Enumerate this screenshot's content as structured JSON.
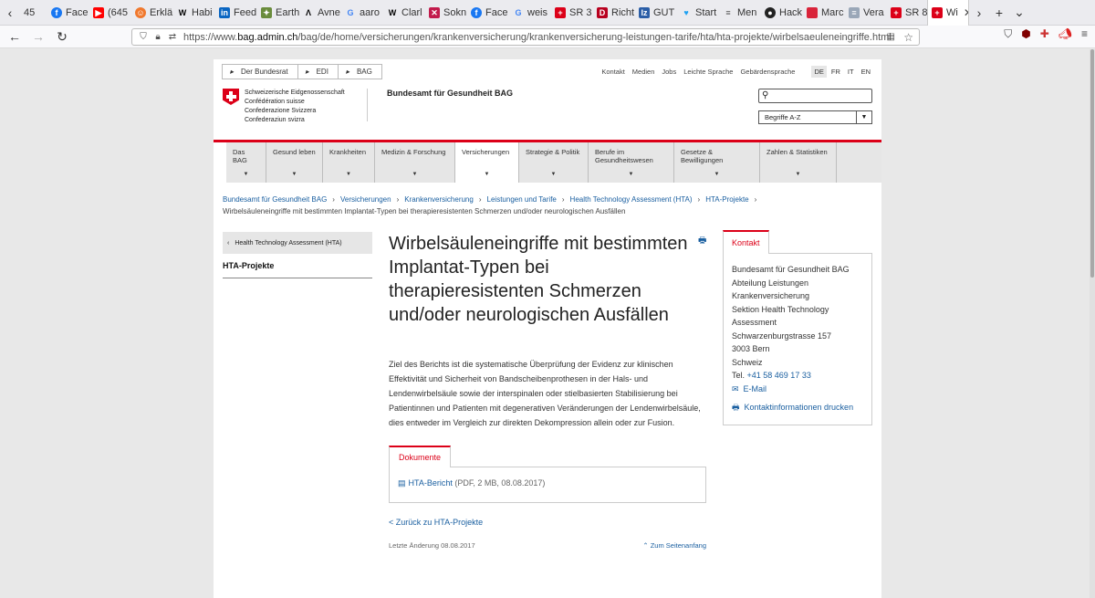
{
  "browser": {
    "tabs": [
      {
        "label": "45"
      },
      {
        "label": "Face"
      },
      {
        "label": "(645"
      },
      {
        "label": "Erklä"
      },
      {
        "label": "Habi"
      },
      {
        "label": "Feed"
      },
      {
        "label": "Earth"
      },
      {
        "label": "Avne"
      },
      {
        "label": "aaro"
      },
      {
        "label": "Clarl"
      },
      {
        "label": "Sokn"
      },
      {
        "label": "Face"
      },
      {
        "label": "weis"
      },
      {
        "label": "SR 3"
      },
      {
        "label": "Richt"
      },
      {
        "label": "GUT"
      },
      {
        "label": "Start"
      },
      {
        "label": "Men"
      },
      {
        "label": "Hack"
      },
      {
        "label": "Marc"
      },
      {
        "label": "Vera"
      },
      {
        "label": "SR 8"
      },
      {
        "label": "Wi"
      }
    ],
    "url_prefix": "https://www.",
    "url_host": "bag.admin.ch",
    "url_path": "/bag/de/home/versicherungen/krankenversicherung/krankenversicherung-leistungen-tarife/hta/hta-projekte/wirbelsaeuleneingriffe.html"
  },
  "topnav": {
    "crumbs": [
      "Der Bundesrat",
      "EDI",
      "BAG"
    ],
    "links": [
      "Kontakt",
      "Medien",
      "Jobs",
      "Leichte Sprache",
      "Gebärdensprache"
    ],
    "languages": [
      "DE",
      "FR",
      "IT",
      "EN"
    ]
  },
  "logo": {
    "lines": [
      "Schweizerische Eidgenossenschaft",
      "Confédération suisse",
      "Confederazione Svizzera",
      "Confederaziun svizra"
    ],
    "office": "Bundesamt für Gesundheit BAG"
  },
  "search": {
    "placeholder": ""
  },
  "az_select": "Begriffe A-Z",
  "mainnav": [
    {
      "label": "Das BAG"
    },
    {
      "label": "Gesund leben"
    },
    {
      "label": "Krankheiten"
    },
    {
      "label": "Medizin & Forschung"
    },
    {
      "label": "Versicherungen"
    },
    {
      "label": "Strategie & Politik"
    },
    {
      "label": "Berufe im Gesundheitswesen"
    },
    {
      "label": "Gesetze & Bewilligungen"
    },
    {
      "label": "Zahlen & Statistiken"
    }
  ],
  "breadcrumb": {
    "items": [
      "Bundesamt für Gesundheit BAG",
      "Versicherungen",
      "Krankenversicherung",
      "Leistungen und Tarife",
      "Health Technology Assessment (HTA)",
      "HTA-Projekte"
    ],
    "current": "Wirbelsäuleneingriffe mit bestimmten Implantat-Typen bei therapieresistenten Schmerzen und/oder neurologischen Ausfällen"
  },
  "sidebar": {
    "back": "Health Technology Assessment (HTA)",
    "current": "HTA-Projekte"
  },
  "main": {
    "title": "Wirbelsäuleneingriffe mit bestimmten Implantat-Typen bei therapieresistenten Schmerzen und/oder neurologischen Ausfällen",
    "lead": "Ziel des Berichts ist die systematische Überprüfung der Evidenz zur klinischen Effektivität und Sicherheit von Bandscheibenprothesen in der Hals- und Lendenwirbelsäule sowie der interspinalen oder stielbasierten Stabilisierung bei Patientinnen und Patienten mit degenerativen Veränderungen der Lendenwirbelsäule, dies entweder im Vergleich zur direkten Dekompression allein oder zur Fusion.",
    "docs_tab": "Dokumente",
    "doc_link": "HTA-Bericht",
    "doc_meta": " (PDF, 2 MB, 08.08.2017)",
    "back_link": "< Zurück zu HTA-Projekte",
    "last_change": "Letzte Änderung 08.08.2017",
    "to_top": "Zum Seitenanfang"
  },
  "kontakt": {
    "tab": "Kontakt",
    "lines": [
      "Bundesamt für Gesundheit BAG",
      "Abteilung Leistungen",
      "Krankenversicherung",
      "Sektion Health Technology",
      "Assessment",
      "Schwarzenburgstrasse 157",
      "3003 Bern",
      "Schweiz"
    ],
    "tel_label": "Tel. ",
    "tel": "+41 58 469 17 33",
    "email": "E-Mail",
    "print": "Kontaktinformationen drucken"
  },
  "colors": {
    "accent": "#dc0018",
    "link": "#1a5fa0"
  }
}
